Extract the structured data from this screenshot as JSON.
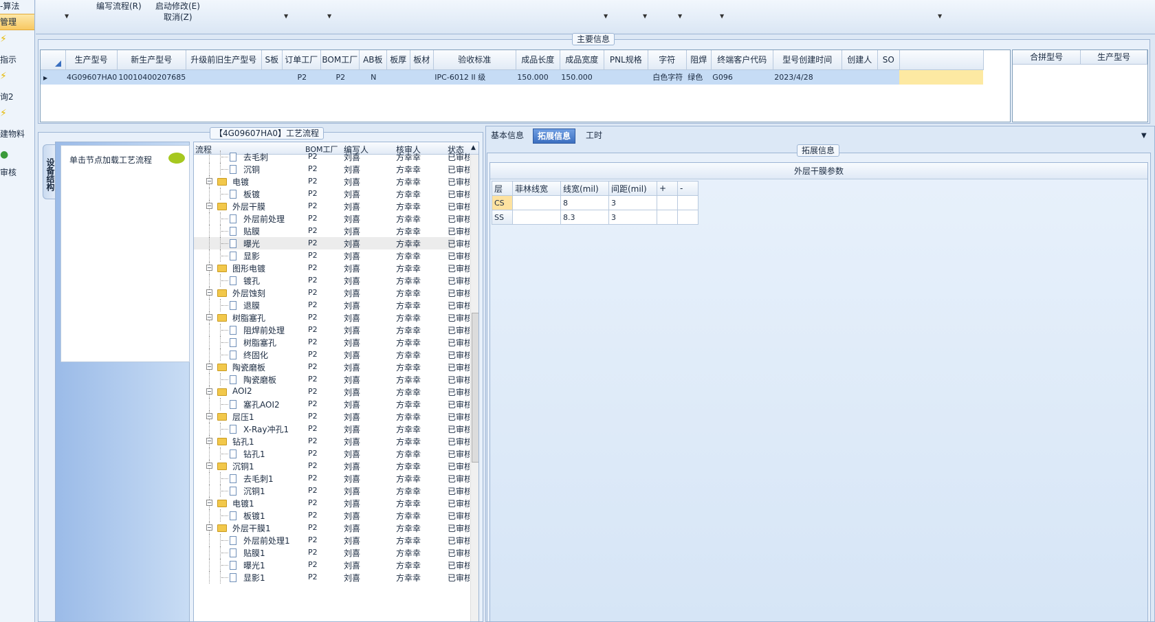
{
  "nav": {
    "items": [
      {
        "label": "-算法"
      },
      {
        "label": "管理"
      },
      {
        "label": "指示"
      },
      {
        "label": "询2"
      },
      {
        "label": "建物料"
      },
      {
        "label": "审核"
      }
    ]
  },
  "toolbar": {
    "write_flow": "编写流程(R)",
    "start_modify": "启动修改(E)",
    "cancel": "取消(Z)"
  },
  "main_info": {
    "title": "主要信息",
    "columns": [
      "生产型号",
      "新生产型号",
      "升级前旧生产型号",
      "S板",
      "订单工厂",
      "BOM工厂",
      "AB板",
      "板厚",
      "板材",
      "验收标准",
      "成品长度",
      "成品宽度",
      "PNL规格",
      "字符",
      "阻焊",
      "终端客户代码",
      "型号创建时间",
      "创建人",
      "SO"
    ],
    "row": [
      "4G09607HA0",
      "10010400207685",
      "",
      "",
      "P2",
      "P2",
      "N",
      "",
      "",
      "IPC-6012 II 级",
      "150.000",
      "150.000",
      "",
      "白色字符",
      "绿色",
      "G096",
      "2023/4/28",
      "",
      ""
    ],
    "side_columns": [
      "合拼型号",
      "生产型号"
    ]
  },
  "process": {
    "title": "【4G09607HA0】工艺流程",
    "side_tab": "设备结构",
    "hint": "单击节点加载工艺流程",
    "headers": {
      "flow": "流程",
      "bom": "BOM工厂",
      "writer": "编写人",
      "checker": "核审人",
      "status": "状态"
    },
    "rows": [
      {
        "name": "去毛刺",
        "type": "doc",
        "bom": "P2",
        "writer": "刘喜",
        "checker": "方幸幸",
        "status": "已审核"
      },
      {
        "name": "沉铜",
        "type": "doc",
        "bom": "P2",
        "writer": "刘喜",
        "checker": "方幸幸",
        "status": "已审核"
      },
      {
        "name": "电镀",
        "type": "folder",
        "bom": "P2",
        "writer": "刘喜",
        "checker": "方幸幸",
        "status": "已审核"
      },
      {
        "name": "板镀",
        "type": "doc",
        "bom": "P2",
        "writer": "刘喜",
        "checker": "方幸幸",
        "status": "已审核"
      },
      {
        "name": "外层干膜",
        "type": "folder",
        "bom": "P2",
        "writer": "刘喜",
        "checker": "方幸幸",
        "status": "已审核"
      },
      {
        "name": "外层前处理",
        "type": "doc",
        "bom": "P2",
        "writer": "刘喜",
        "checker": "方幸幸",
        "status": "已审核"
      },
      {
        "name": "贴膜",
        "type": "doc",
        "bom": "P2",
        "writer": "刘喜",
        "checker": "方幸幸",
        "status": "已审核"
      },
      {
        "name": "曝光",
        "type": "doc",
        "bom": "P2",
        "writer": "刘喜",
        "checker": "方幸幸",
        "status": "已审核",
        "highlight": true
      },
      {
        "name": "显影",
        "type": "doc",
        "bom": "P2",
        "writer": "刘喜",
        "checker": "方幸幸",
        "status": "已审核"
      },
      {
        "name": "图形电镀",
        "type": "folder",
        "bom": "P2",
        "writer": "刘喜",
        "checker": "方幸幸",
        "status": "已审核"
      },
      {
        "name": "镀孔",
        "type": "doc",
        "bom": "P2",
        "writer": "刘喜",
        "checker": "方幸幸",
        "status": "已审核"
      },
      {
        "name": "外层蚀刻",
        "type": "folder",
        "bom": "P2",
        "writer": "刘喜",
        "checker": "方幸幸",
        "status": "已审核"
      },
      {
        "name": "退膜",
        "type": "doc",
        "bom": "P2",
        "writer": "刘喜",
        "checker": "方幸幸",
        "status": "已审核"
      },
      {
        "name": "树脂塞孔",
        "type": "folder",
        "bom": "P2",
        "writer": "刘喜",
        "checker": "方幸幸",
        "status": "已审核"
      },
      {
        "name": "阻焊前处理",
        "type": "doc",
        "bom": "P2",
        "writer": "刘喜",
        "checker": "方幸幸",
        "status": "已审核"
      },
      {
        "name": "树脂塞孔",
        "type": "doc",
        "bom": "P2",
        "writer": "刘喜",
        "checker": "方幸幸",
        "status": "已审核"
      },
      {
        "name": "终固化",
        "type": "doc",
        "bom": "P2",
        "writer": "刘喜",
        "checker": "方幸幸",
        "status": "已审核"
      },
      {
        "name": "陶瓷磨板",
        "type": "folder",
        "bom": "P2",
        "writer": "刘喜",
        "checker": "方幸幸",
        "status": "已审核"
      },
      {
        "name": "陶瓷磨板",
        "type": "doc",
        "bom": "P2",
        "writer": "刘喜",
        "checker": "方幸幸",
        "status": "已审核"
      },
      {
        "name": "AOI2",
        "type": "folder",
        "bom": "P2",
        "writer": "刘喜",
        "checker": "方幸幸",
        "status": "已审核"
      },
      {
        "name": "塞孔AOI2",
        "type": "doc",
        "bom": "P2",
        "writer": "刘喜",
        "checker": "方幸幸",
        "status": "已审核"
      },
      {
        "name": "层压1",
        "type": "folder",
        "bom": "P2",
        "writer": "刘喜",
        "checker": "方幸幸",
        "status": "已审核"
      },
      {
        "name": "X-Ray冲孔1",
        "type": "doc",
        "bom": "P2",
        "writer": "刘喜",
        "checker": "方幸幸",
        "status": "已审核"
      },
      {
        "name": "钻孔1",
        "type": "folder",
        "bom": "P2",
        "writer": "刘喜",
        "checker": "方幸幸",
        "status": "已审核"
      },
      {
        "name": "钻孔1",
        "type": "doc",
        "bom": "P2",
        "writer": "刘喜",
        "checker": "方幸幸",
        "status": "已审核"
      },
      {
        "name": "沉铜1",
        "type": "folder",
        "bom": "P2",
        "writer": "刘喜",
        "checker": "方幸幸",
        "status": "已审核"
      },
      {
        "name": "去毛刺1",
        "type": "doc",
        "bom": "P2",
        "writer": "刘喜",
        "checker": "方幸幸",
        "status": "已审核"
      },
      {
        "name": "沉铜1",
        "type": "doc",
        "bom": "P2",
        "writer": "刘喜",
        "checker": "方幸幸",
        "status": "已审核"
      },
      {
        "name": "电镀1",
        "type": "folder",
        "bom": "P2",
        "writer": "刘喜",
        "checker": "方幸幸",
        "status": "已审核"
      },
      {
        "name": "板镀1",
        "type": "doc",
        "bom": "P2",
        "writer": "刘喜",
        "checker": "方幸幸",
        "status": "已审核"
      },
      {
        "name": "外层干膜1",
        "type": "folder",
        "bom": "P2",
        "writer": "刘喜",
        "checker": "方幸幸",
        "status": "已审核"
      },
      {
        "name": "外层前处理1",
        "type": "doc",
        "bom": "P2",
        "writer": "刘喜",
        "checker": "方幸幸",
        "status": "已审核"
      },
      {
        "name": "贴膜1",
        "type": "doc",
        "bom": "P2",
        "writer": "刘喜",
        "checker": "方幸幸",
        "status": "已审核"
      },
      {
        "name": "曝光1",
        "type": "doc",
        "bom": "P2",
        "writer": "刘喜",
        "checker": "方幸幸",
        "status": "已审核"
      },
      {
        "name": "显影1",
        "type": "doc",
        "bom": "P2",
        "writer": "刘喜",
        "checker": "方幸幸",
        "status": "已审核"
      }
    ]
  },
  "detail": {
    "tabs": [
      "基本信息",
      "拓展信息",
      "工时"
    ],
    "active_tab": 1,
    "group_title": "拓展信息",
    "section_title": "外层干膜参数",
    "param_headers": [
      "层",
      "菲林线宽",
      "线宽(mil)",
      "间距(mil)",
      "+",
      "-"
    ],
    "param_rows": [
      [
        "CS",
        "",
        "8",
        "3",
        "",
        ""
      ],
      [
        "SS",
        "",
        "8.3",
        "3",
        "",
        ""
      ]
    ]
  }
}
